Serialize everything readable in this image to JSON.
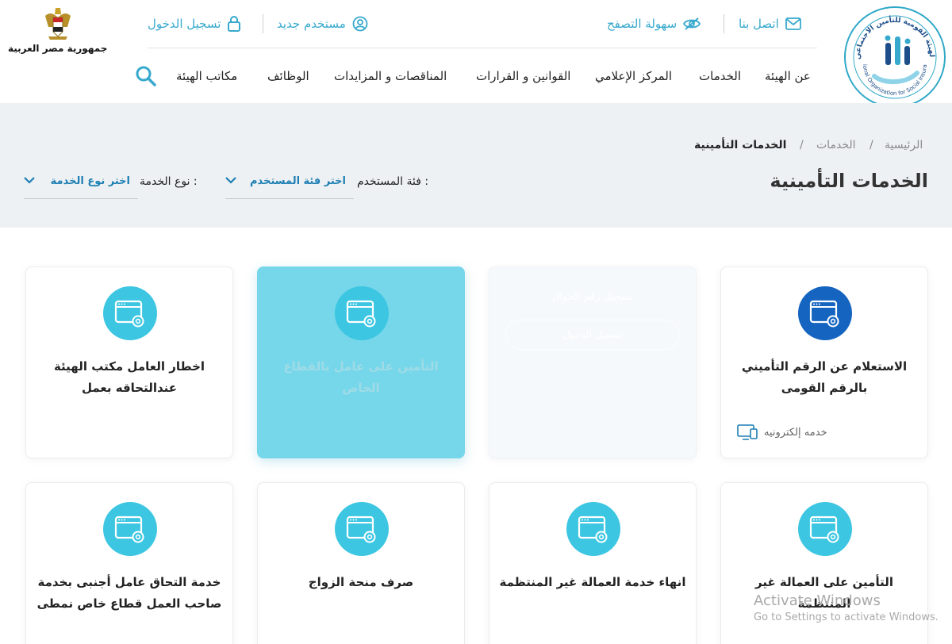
{
  "header": {
    "logo_text": "الهيئة القومية للتأمين الاجتماعي National Organization for Social Insurance",
    "country_name": "جمهورية مصر العربية",
    "top_links": {
      "contact": "اتصل بنا",
      "accessibility": "سهولة التصفح",
      "new_user": "مستخدم جديد",
      "login": "تسجيل الدخول"
    },
    "nav": {
      "about": "عن الهيئة",
      "services": "الخدمات",
      "media": "المركز الإعلامي",
      "laws": "القوانين و القرارات",
      "tenders": "المناقصات و المزايدات",
      "jobs": "الوظائف",
      "offices": "مكاتب الهيئة"
    }
  },
  "breadcrumb": {
    "home": "الرئيسية",
    "services": "الخدمات",
    "current": "الخدمات التأمينية",
    "separator": "/"
  },
  "page_title": "الخدمات التأمينية",
  "filters": {
    "user_category_label": "فئة المستخدم :",
    "user_category_value": "اختر فئة المستخدم",
    "service_type_label": "نوع الخدمة :",
    "service_type_value": "اختر نوع الخدمة"
  },
  "cards": [
    {
      "title": "الاستعلام عن الرقم التأميني بالرقم القومى",
      "tag": "خدمه إلكترونيه",
      "icon": "browser-gear-icon"
    },
    {
      "ghost_text": "تسجيل رقم الجوال",
      "ghost_button": "تسجيل الدخول"
    },
    {
      "title": "التأمين على عامل بالقطاع الخاص",
      "icon": "browser-gear-icon"
    },
    {
      "title": "اخطار العامل مكتب الهيئة عندالتحاقه بعمل",
      "icon": "browser-gear-icon"
    },
    {
      "title": "التأمين على العمالة غير المنتظمة",
      "icon": "browser-gear-icon"
    },
    {
      "title": "انهاء خدمة العمالة غير المنتظمة",
      "icon": "browser-gear-icon"
    },
    {
      "title": "صرف منحة الزواج",
      "icon": "browser-gear-icon"
    },
    {
      "title": "خدمة التحاق عامل أجنبى بخدمة صاحب العمل قطاع خاص نمطى",
      "icon": "browser-gear-icon"
    }
  ],
  "watermark": {
    "line1": "Activate Windows",
    "line2": "Go to Settings to activate Windows."
  },
  "colors": {
    "accent": "#37a9cd",
    "icon_circle": "#3cc6e2",
    "icon_circle_dark": "#1565c0",
    "highlight_card": "#76d7ea",
    "banner_bg": "#eef1f4",
    "link_blue": "#1d7fb3"
  }
}
